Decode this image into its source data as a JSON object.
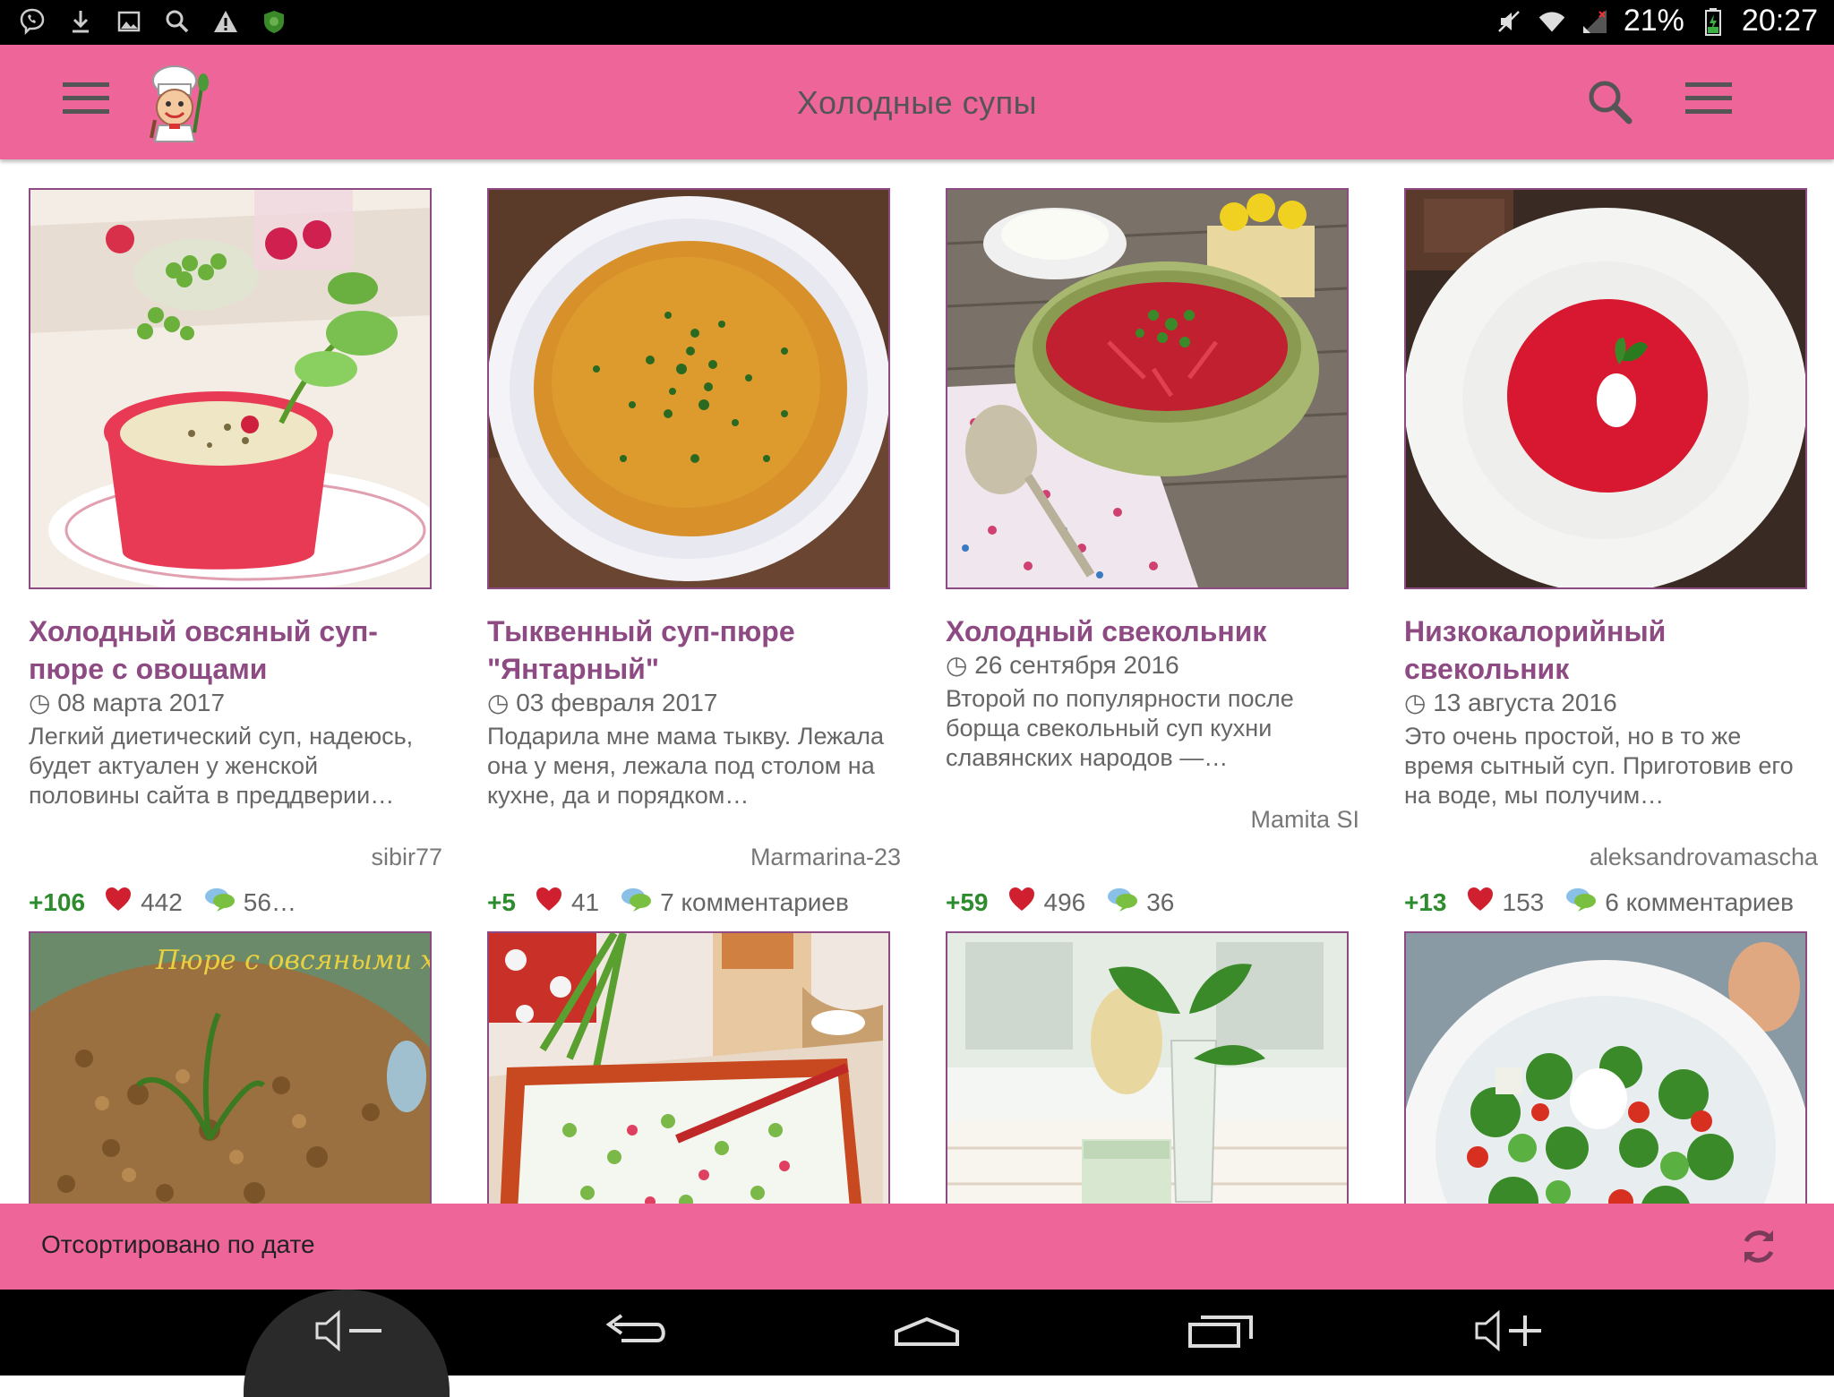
{
  "status_bar": {
    "battery": "21%",
    "time": "20:27"
  },
  "app_bar": {
    "title": "Холодные супы"
  },
  "recipes": [
    {
      "title": "Холодный овсяный суп-пюре с овощами",
      "date": "08 марта 2017",
      "description": "Легкий диетический суп, надеюсь, будет актуален у женской половины сайта в преддверии…",
      "author": "sibir77",
      "score": "+106",
      "likes": "442",
      "comments": "56…",
      "photo": "radish-soup-photo"
    },
    {
      "title": "Тыквенный суп-пюре \"Янтарный\"",
      "date": "03 февраля 2017",
      "description": "Подарила мне мама тыкву. Лежала она у меня, лежала под столом на кухне, да и порядком…",
      "author": "Marmarina-23",
      "score": "+5",
      "likes": "41",
      "comments": "7 комментариев",
      "photo": "pumpkin-soup-photo"
    },
    {
      "title": "Холодный свекольник",
      "date": "26 сентября 2016",
      "description": "Второй по популярности после борща свекольный суп кухни славянских народов —…",
      "author": "Mamita SI",
      "score": "+59",
      "likes": "496",
      "comments": "36",
      "photo": "beet-soup-bowl-photo"
    },
    {
      "title": "Низкокалорийный свекольник",
      "date": "13 августа 2016",
      "description": "Это очень простой, но в то же время сытный суп. Приготовив его на воде, мы получим…",
      "author": "aleksandrovamascha",
      "score": "+13",
      "likes": "153",
      "comments": "6 комментариев",
      "photo": "beet-cream-soup-photo"
    }
  ],
  "second_row_overlay": "Пюре с овсяными хлоп",
  "bottom_bar": {
    "sort_label": "Отсортировано по дате"
  },
  "colors": {
    "accent": "#ee6699",
    "title_purple": "#8e4a82",
    "score_green": "#2e8b2e",
    "heart_red": "#d02030"
  }
}
